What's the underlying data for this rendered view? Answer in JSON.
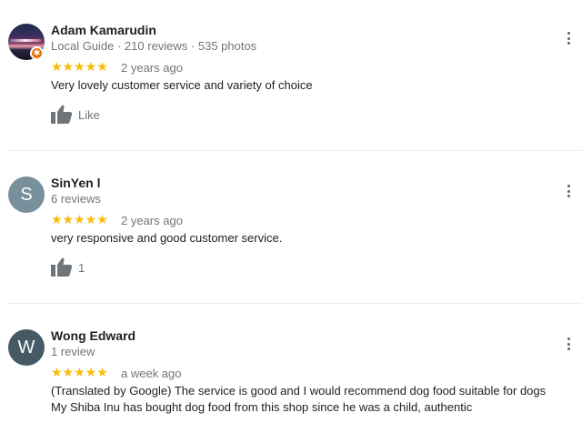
{
  "reviews": [
    {
      "name": "Adam Kamarudin",
      "meta": "Local Guide · 210 reviews · 535 photos",
      "stars": "★★★★★",
      "rating": 5,
      "ago": "2 years ago",
      "text": [
        "Very lovely customer service and variety of choice"
      ],
      "like_label": "Like",
      "avatar_type": "photo",
      "avatar_initial": "",
      "local_guide": true
    },
    {
      "name": "SinYen l",
      "meta": "6 reviews",
      "stars": "★★★★★",
      "rating": 5,
      "ago": "2 years ago",
      "text": [
        "very responsive and good customer service."
      ],
      "like_label": "1",
      "avatar_type": "initial",
      "avatar_initial": "S",
      "avatar_color": "#78909c",
      "local_guide": false
    },
    {
      "name": "Wong Edward",
      "meta": "1 review",
      "stars": "★★★★★",
      "rating": 5,
      "ago": "a week ago",
      "text": [
        "(Translated by Google) The service is good and I would recommend dog food suitable for dogs",
        "My Shiba Inu has bought dog food from this shop since he was a child, authentic"
      ],
      "like_label": "",
      "avatar_type": "initial",
      "avatar_initial": "W",
      "avatar_color": "#455a64",
      "local_guide": false
    }
  ],
  "colors": {
    "star": "#fbbc04",
    "secondary_text": "#70757a",
    "primary_text": "#202124",
    "local_guide_badge": "#e8710a"
  },
  "icons": {
    "like": "thumbs-up-icon",
    "more": "more-vert-icon",
    "badge": "local-guide-badge-icon"
  }
}
